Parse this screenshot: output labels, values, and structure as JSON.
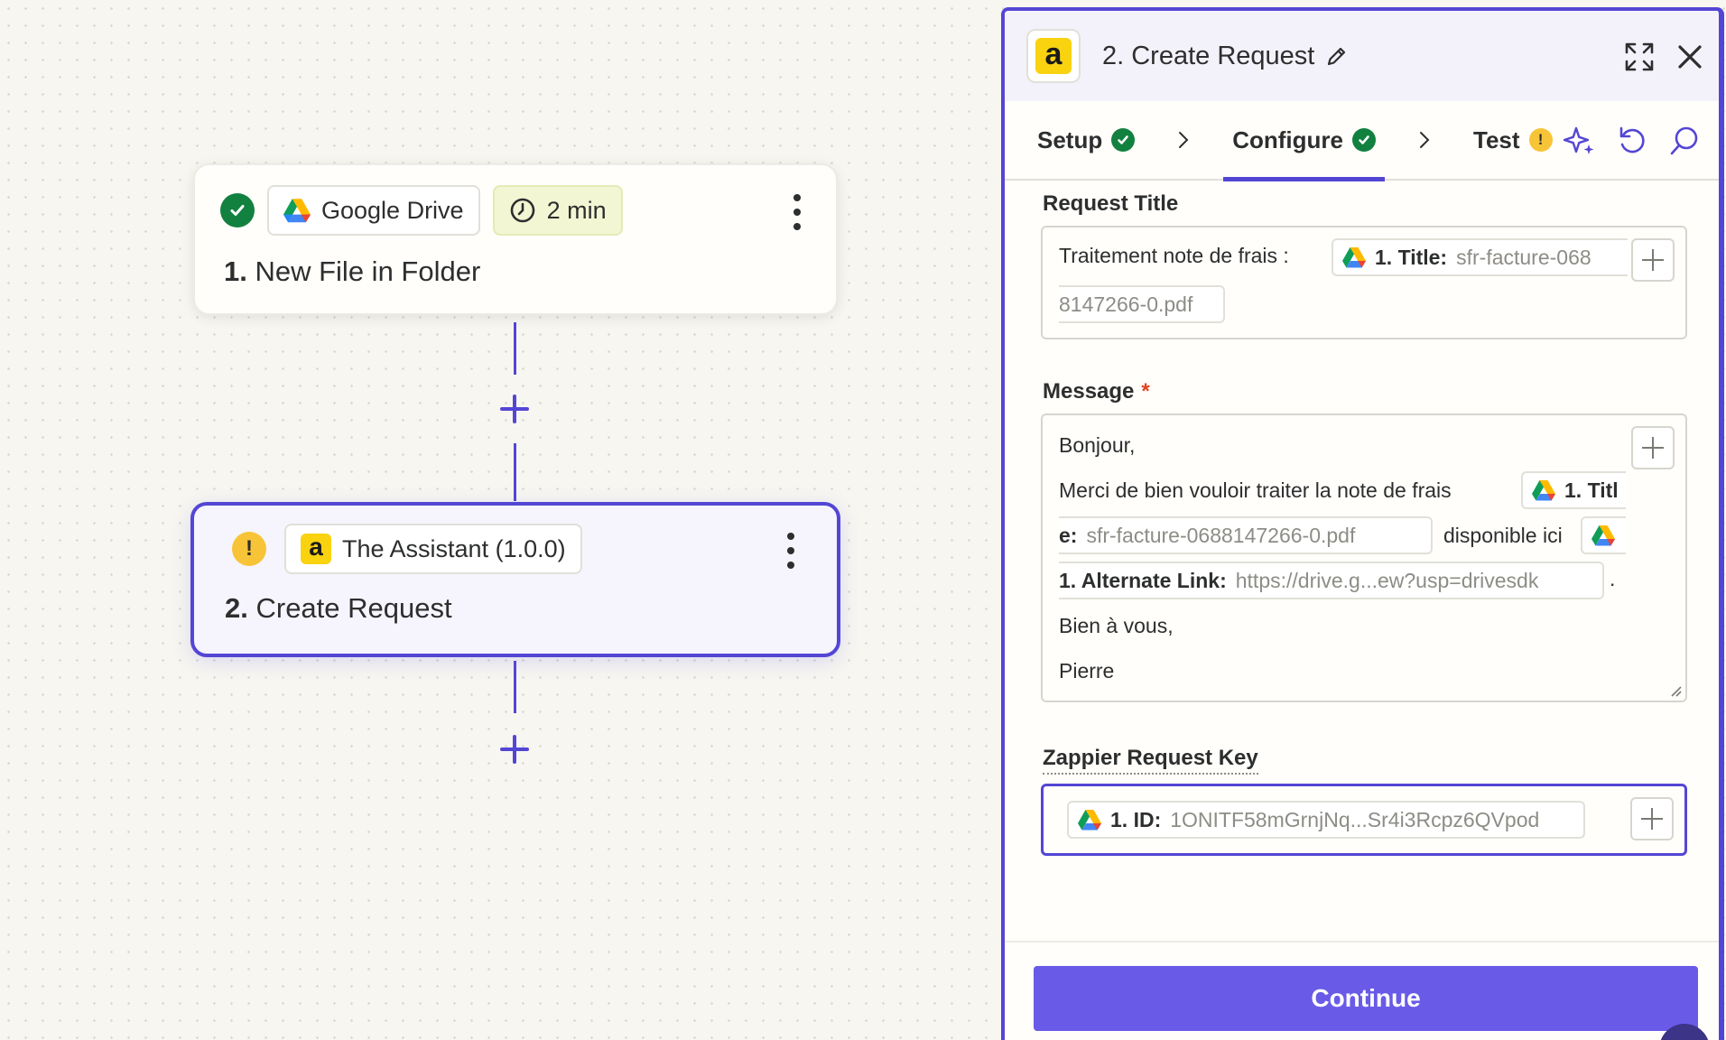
{
  "canvas": {
    "trigger": {
      "app": "Google Drive",
      "time": "2 min",
      "step_number": "1.",
      "step_title": "New File in Folder"
    },
    "action": {
      "app": "The Assistant (1.0.0)",
      "step_number": "2.",
      "step_title": "Create Request"
    }
  },
  "panel": {
    "app_icon_letter": "a",
    "title": "2. Create Request",
    "tabs": [
      {
        "label": "Setup",
        "status": "complete"
      },
      {
        "label": "Configure",
        "status": "complete"
      },
      {
        "label": "Test",
        "status": "warning"
      }
    ],
    "fields": {
      "request_title": {
        "label": "Request Title",
        "text": "Traitement note de frais :",
        "token": {
          "key": "1. Title:",
          "value_a": "sfr-facture-068",
          "value_b": "8147266-0.pdf"
        }
      },
      "message": {
        "label": "Message",
        "required_mark": "*",
        "line1": "Bonjour,",
        "line2": "Merci de bien vouloir traiter la note de frais",
        "token1": {
          "key_a": "1. Titl",
          "key_b": "e:",
          "value": "sfr-facture-0688147266-0.pdf"
        },
        "mid_text": "disponible ici",
        "token2": {
          "key": "1. Alternate Link:",
          "value": "https://drive.g...ew?usp=drivesdk"
        },
        "period": ".",
        "line4": "Bien à vous,",
        "line5": "Pierre"
      },
      "request_key": {
        "label": "Zappier Request Key",
        "token": {
          "key": "1. ID:",
          "value": "1ONITF58mGrnjNq...Sr4i3Rcpz6QVpod"
        }
      }
    },
    "continue_label": "Continue"
  },
  "colors": {
    "accent": "#5446d4",
    "button": "#695be8",
    "success": "#12813f",
    "warning": "#f8c437",
    "assistant_brand": "#f9d210"
  }
}
